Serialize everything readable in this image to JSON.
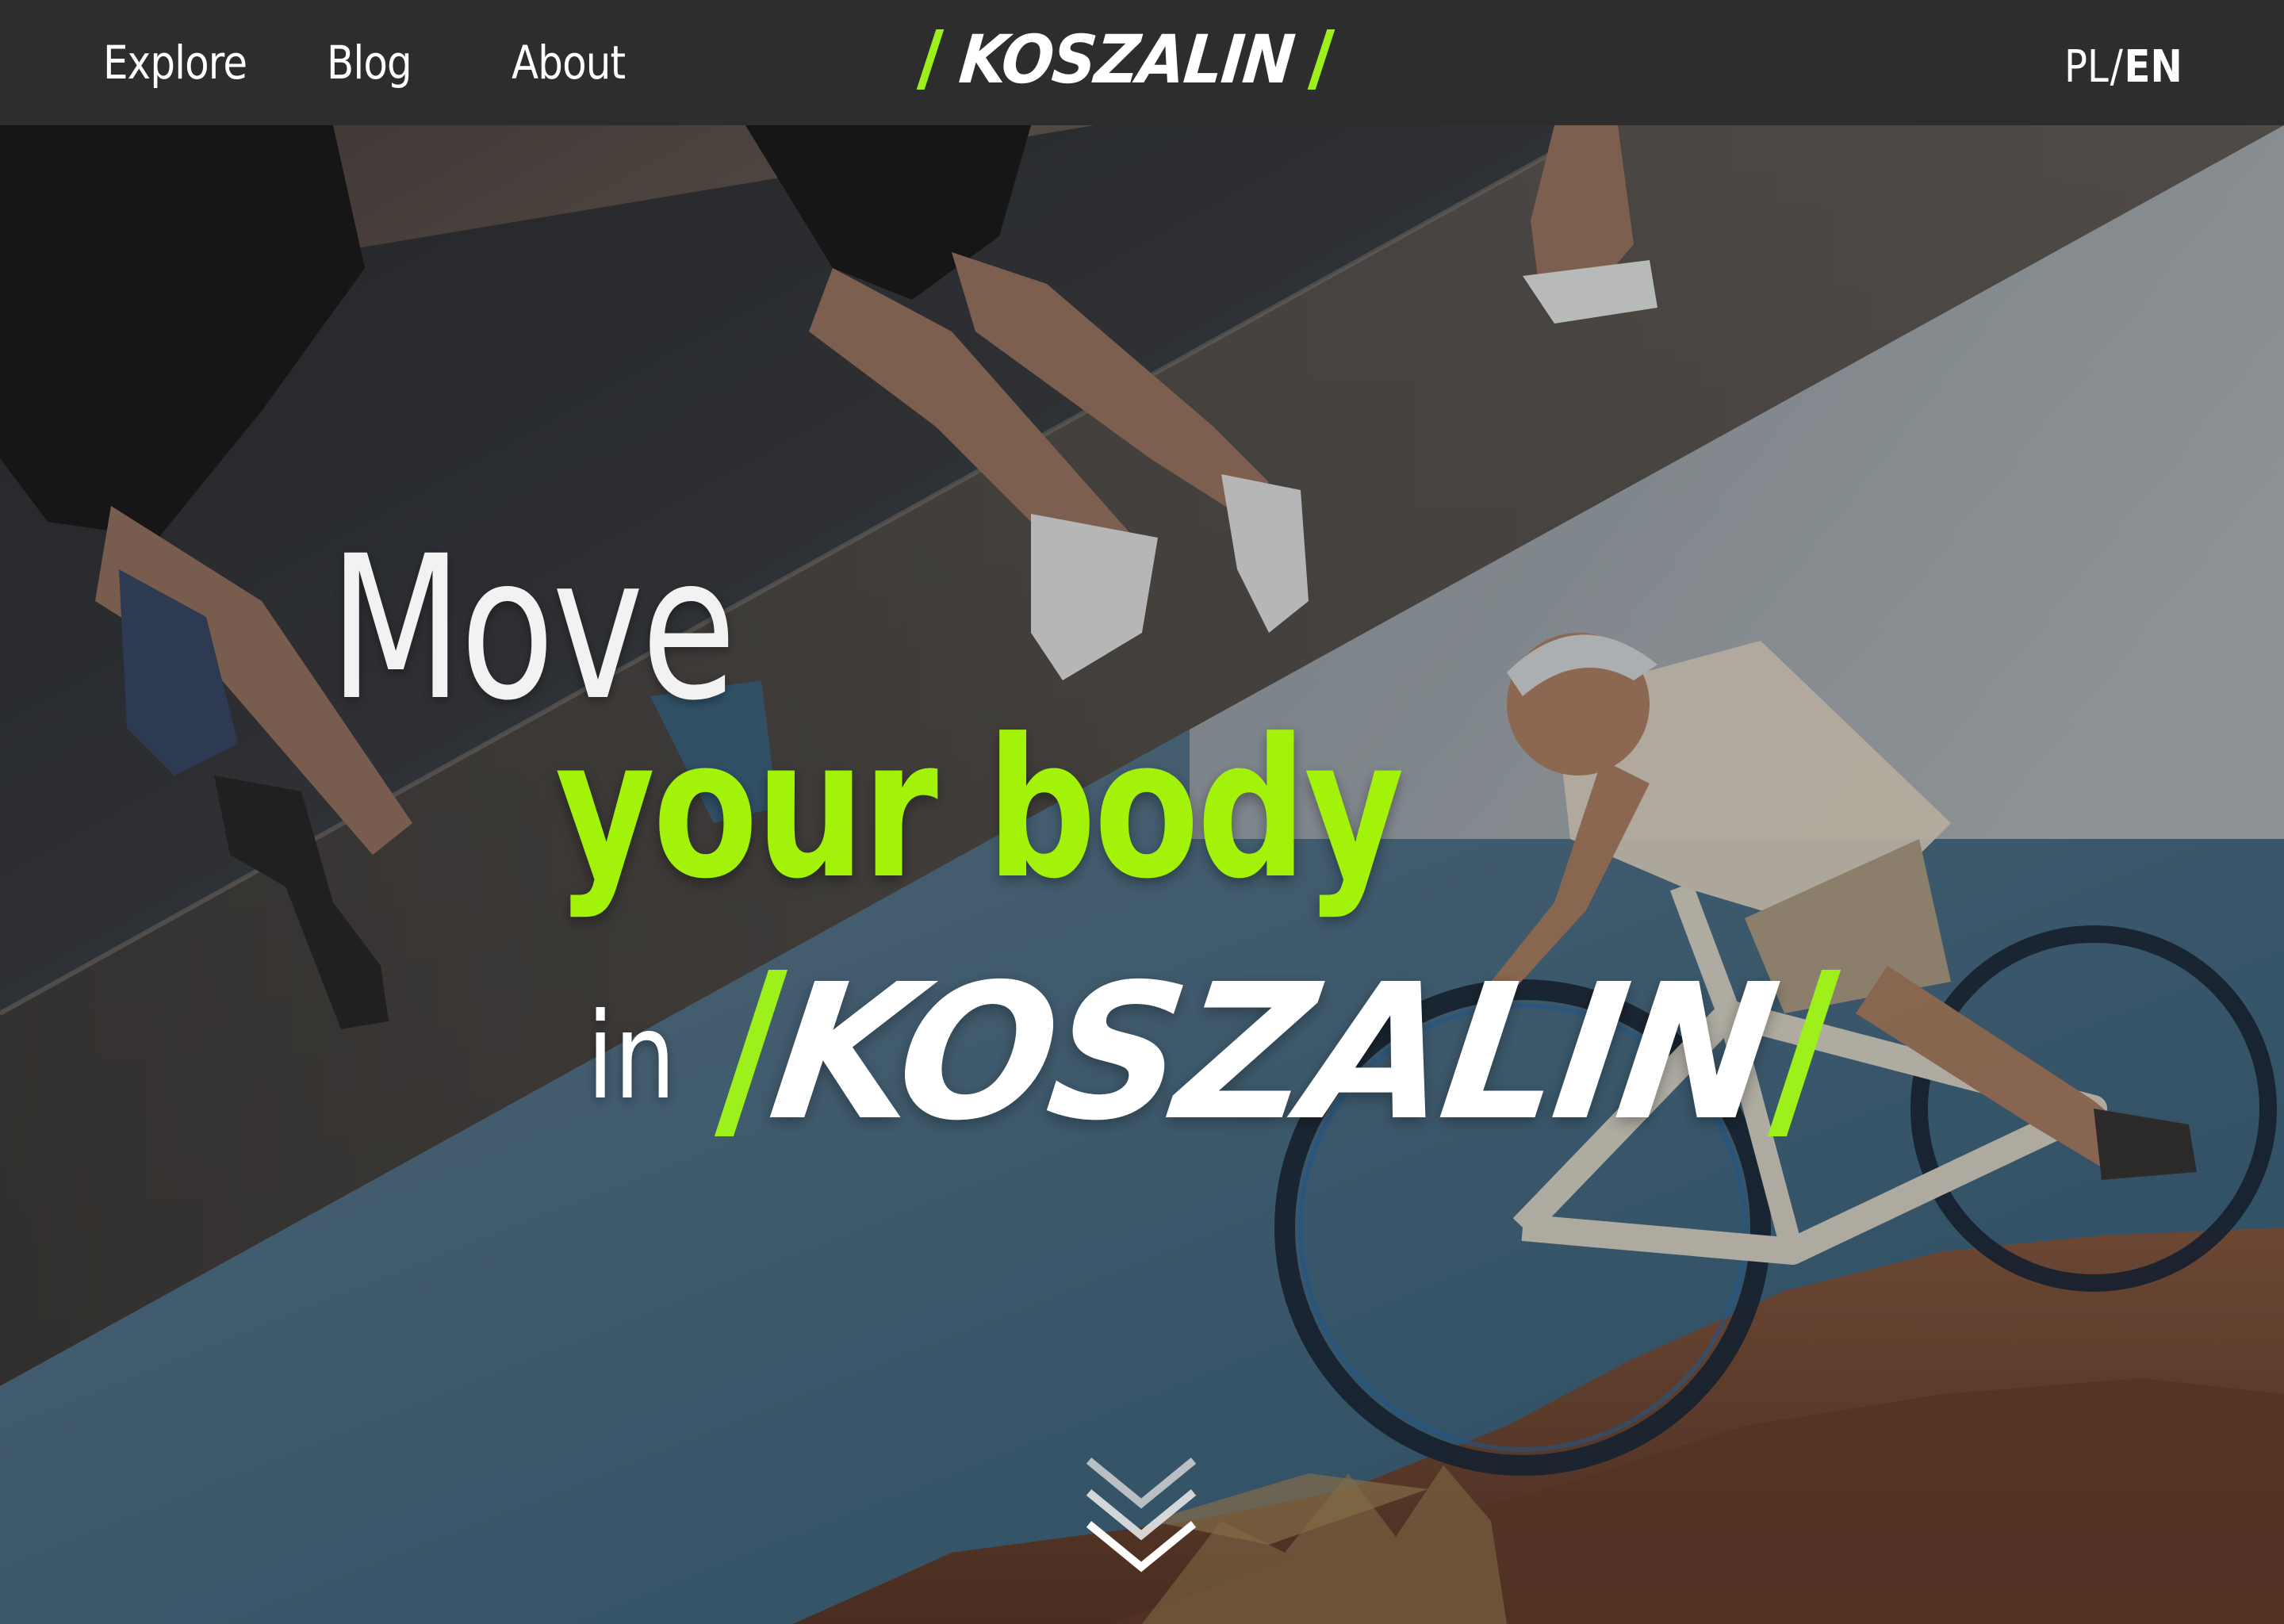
{
  "nav": {
    "links": [
      {
        "label": "Explore"
      },
      {
        "label": "Blog"
      },
      {
        "label": "About"
      }
    ],
    "logo_text": "KOSZALIN",
    "language": {
      "pl": "PL",
      "separator": "/",
      "en": "EN",
      "active": "EN"
    }
  },
  "hero": {
    "line1": "Move",
    "line2": "your body",
    "line3_prefix": "in",
    "line3_logo": "KOSZALIN"
  },
  "scroll_icon": "double-chevron-down-icon",
  "colors": {
    "navbar_bg": "#2d2d2d",
    "accent_green": "#a3f20a",
    "text_white": "#ffffff"
  }
}
